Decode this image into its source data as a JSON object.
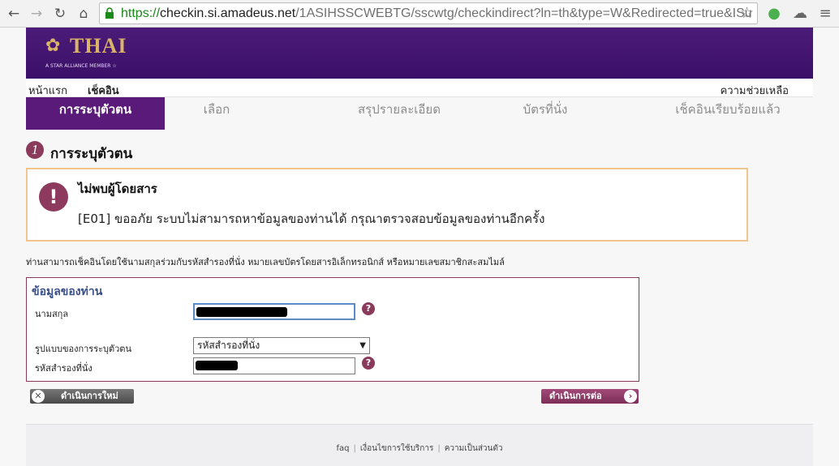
{
  "browser": {
    "url_https": "https://",
    "url_host": "checkin.si.amadeus.net",
    "url_path": "/1ASIHSSCWEBTG/sscwtg/checkindirect?ln=th&type=W&Redirected=true&ISu"
  },
  "header": {
    "brand": "THAI",
    "tagline": "A STAR ALLIANCE MEMBER ☆"
  },
  "topnav": {
    "home": "หน้าแรก",
    "checkin": "เช็คอิน",
    "help": "ความช่วยเหลือ"
  },
  "steps": [
    {
      "label": "การระบุตัวตน",
      "active": true
    },
    {
      "label": "เลือก",
      "active": false
    },
    {
      "label": "สรุปรายละเอียด",
      "active": false
    },
    {
      "label": "บัตรที่นั่ง",
      "active": false
    },
    {
      "label": "เช็คอินเรียบร้อยแล้ว",
      "active": false
    }
  ],
  "section": {
    "number": "1",
    "title": "การระบุตัวตน"
  },
  "error": {
    "title": "ไม่พบผู้โดยสาร",
    "message": "[E01] ขออภัย ระบบไม่สามารถหาข้อมูลของท่านได้ กรุณาตรวจสอบข้อมูลของท่านอีกครั้ง"
  },
  "info_text": "ท่านสามารถเช็คอินโดยใช้นามสกุลร่วมกับรหัสสำรองที่นั่ง หมายเลขบัตรโดยสารอิเล็กทรอนิกส์ หรือหมายเลขสมาชิกสะสมไมล์",
  "form": {
    "legend": "ข้อมูลของท่าน",
    "lastname_label": "นามสกุล",
    "idtype_label": "รูปแบบของการระบุตัวตน",
    "idtype_value": "รหัสสำรองที่นั่ง",
    "booking_label": "รหัสสำรองที่นั่ง"
  },
  "buttons": {
    "reset": "ดำเนินการใหม่",
    "next": "ดำเนินการต่อ"
  },
  "footer": {
    "faq": "faq",
    "terms": "เงื่อนไขการใช้บริการ",
    "privacy": "ความเป็นส่วนตัว"
  },
  "colors": {
    "brand_purple": "#4b1c79",
    "accent_plum": "#8a3a5a",
    "error_border": "#f0c48c"
  }
}
